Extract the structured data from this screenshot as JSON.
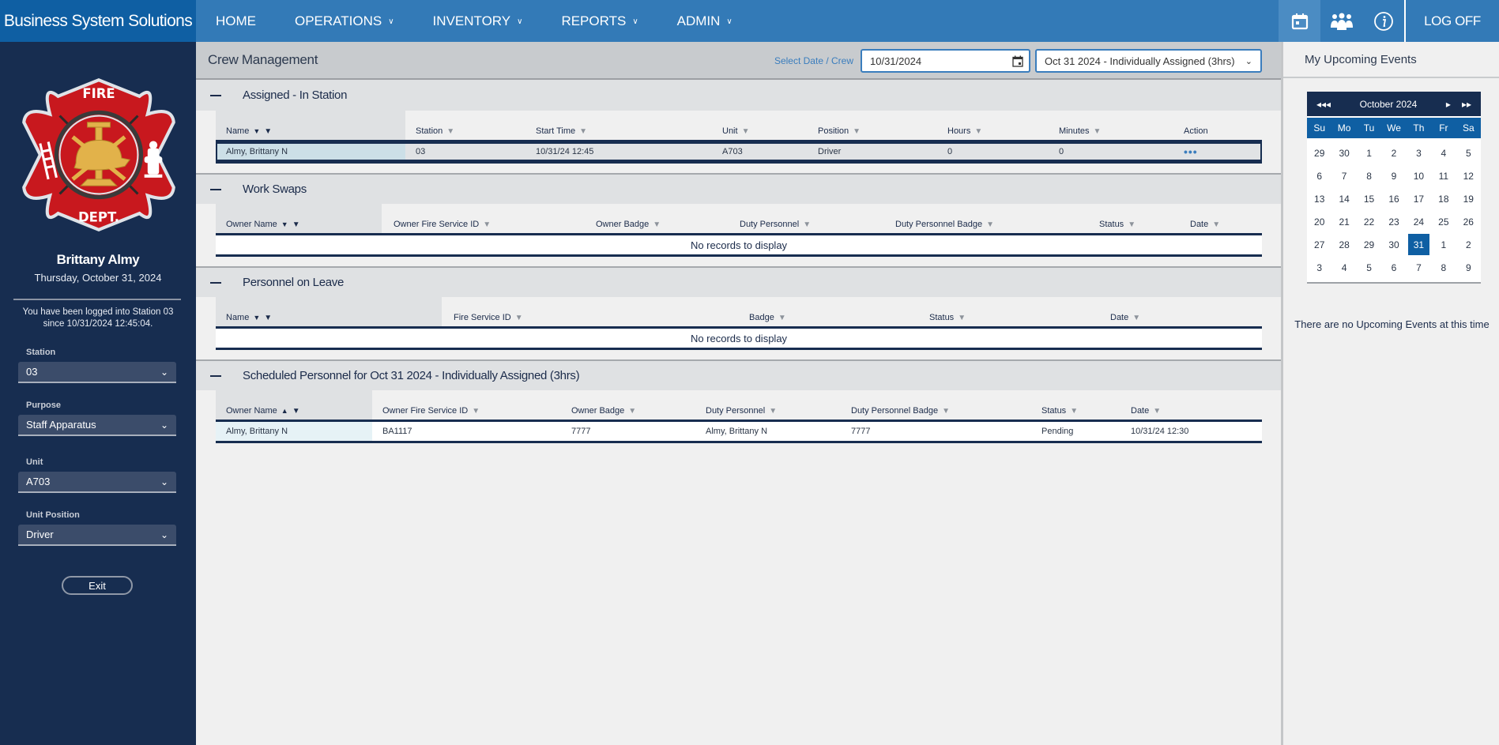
{
  "app": {
    "brand": "Business System Solutions"
  },
  "nav": {
    "items": [
      {
        "label": "HOME",
        "has_dropdown": false
      },
      {
        "label": "OPERATIONS",
        "has_dropdown": true
      },
      {
        "label": "INVENTORY",
        "has_dropdown": true
      },
      {
        "label": "REPORTS",
        "has_dropdown": true
      },
      {
        "label": "ADMIN",
        "has_dropdown": true
      }
    ],
    "icons": [
      "calendar-icon",
      "group-icon",
      "info-icon"
    ],
    "logoff_label": "LOG OFF",
    "chevron": "⌄"
  },
  "sidebar": {
    "logo": {
      "top_text": "FIRE",
      "bottom_text": "DEPT."
    },
    "user_name": "Brittany Almy",
    "date": "Thursday, October 31, 2024",
    "login_info": "You have been logged into Station 03 since 10/31/2024 12:45:04.",
    "fields": {
      "station": {
        "label": "Station",
        "value": "03"
      },
      "purpose": {
        "label": "Purpose",
        "value": "Staff Apparatus"
      },
      "unit": {
        "label": "Unit",
        "value": "A703"
      },
      "unit_position": {
        "label": "Unit Position",
        "value": "Driver"
      }
    },
    "exit_label": "Exit"
  },
  "main": {
    "title": "Crew Management",
    "select_label": "Select Date / Crew",
    "date_value": "10/31/2024",
    "crew_value": "Oct 31 2024 - Individually Assigned (3hrs)",
    "sections": {
      "assigned": {
        "title": "Assigned - In Station",
        "columns": [
          "Name",
          "Station",
          "Start Time",
          "Unit",
          "Position",
          "Hours",
          "Minutes",
          "Action"
        ],
        "rows": [
          {
            "name": "Almy, Brittany N",
            "station": "03",
            "start_time": "10/31/24 12:45",
            "unit": "A703",
            "position": "Driver",
            "hours": "0",
            "minutes": "0",
            "action": "•••"
          }
        ]
      },
      "work_swaps": {
        "title": "Work Swaps",
        "columns": [
          "Owner Name",
          "Owner Fire Service ID",
          "Owner Badge",
          "Duty Personnel",
          "Duty Personnel Badge",
          "Status",
          "Date"
        ],
        "empty": "No records to display"
      },
      "leave": {
        "title": "Personnel on Leave",
        "columns": [
          "Name",
          "Fire Service ID",
          "Badge",
          "Status",
          "Date"
        ],
        "empty": "No records to display"
      },
      "scheduled": {
        "title": "Scheduled Personnel for Oct 31 2024 - Individually Assigned (3hrs)",
        "columns": [
          "Owner Name",
          "Owner Fire Service ID",
          "Owner Badge",
          "Duty Personnel",
          "Duty Personnel Badge",
          "Status",
          "Date"
        ],
        "rows": [
          {
            "owner_name": "Almy, Brittany N",
            "owner_fsid": "BA1117",
            "owner_badge": "7777",
            "duty_personnel": "Almy, Brittany N",
            "duty_badge": "7777",
            "status": "Pending",
            "date": "10/31/24 12:30"
          }
        ]
      }
    }
  },
  "right_panel": {
    "title": "My Upcoming Events",
    "calendar": {
      "month_label": "October 2024",
      "nav": {
        "prev_year": "◂◂",
        "prev": "◂",
        "next": "▸",
        "next_year": "▸▸"
      },
      "dow": [
        "Su",
        "Mo",
        "Tu",
        "We",
        "Th",
        "Fr",
        "Sa"
      ],
      "days": [
        "29",
        "30",
        "1",
        "2",
        "3",
        "4",
        "5",
        "6",
        "7",
        "8",
        "9",
        "10",
        "11",
        "12",
        "13",
        "14",
        "15",
        "16",
        "17",
        "18",
        "19",
        "20",
        "21",
        "22",
        "23",
        "24",
        "25",
        "26",
        "27",
        "28",
        "29",
        "30",
        "31",
        "1",
        "2",
        "3",
        "4",
        "5",
        "6",
        "7",
        "8",
        "9"
      ],
      "selected_index": 32
    },
    "no_events": "There are no Upcoming Events at this time"
  }
}
